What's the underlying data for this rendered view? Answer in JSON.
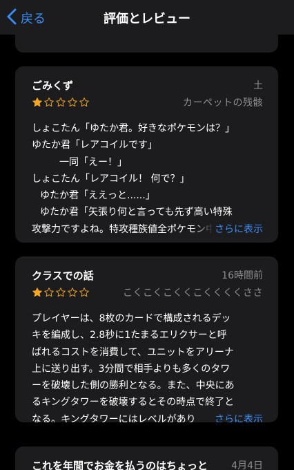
{
  "nav": {
    "back_label": "戻る",
    "title": "評価とレビュー"
  },
  "colors": {
    "accent": "#3a8cf5",
    "star": "#f5a623",
    "card": "#1c1c1e",
    "muted": "#8e8e93"
  },
  "reviews": [
    {
      "title": "ごみくず",
      "date": "土",
      "rating": 1,
      "max_rating": 5,
      "author": "カーペットの残骸",
      "lines": [
        "しょこたん「ゆたか君。好きなポケモンは？」",
        "ゆたか君「レアコイルです」",
        "一同「えー！」",
        "しょこたん「レアコイル！ 何で？」",
        "ゆたか君「ええっと......」",
        "ゆたか君「矢張り何と言っても先ず高い特殊",
        "攻撃力ですよね。特攻種族値全ポケモン中"
      ],
      "more": "さらに表示"
    },
    {
      "title": "クラスでの話",
      "date": "16時間前",
      "rating": 1,
      "max_rating": 5,
      "author": "こくこくこくくこくくくくささ",
      "lines": [
        "プレイヤーは、8枚のカードで構成されるデッ",
        "キを編成し、2.8秒に1たまるエリクサーと呼",
        "ばれるコストを消費して、ユニットをアリーナ",
        "上に送り出す。3分間で相手よりも多くのタワ",
        "ーを破壊した側の勝利となる。また、中央にあ",
        "るキングタワーを破壊するとその時点で終了と",
        "なる。キングタワーにはレベルがあり"
      ],
      "more": "さらに表示"
    },
    {
      "title": "これを年間でお金を払うのはちょっと",
      "date": "4月4日"
    }
  ]
}
